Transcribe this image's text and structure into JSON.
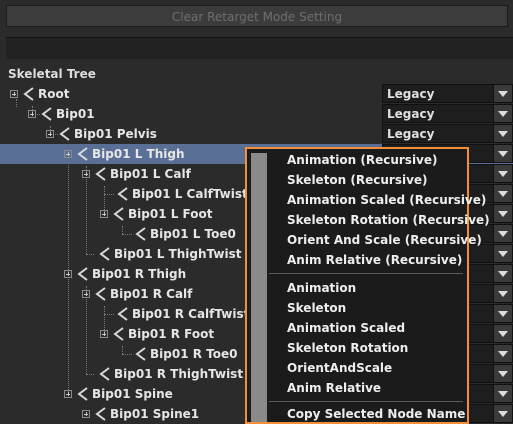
{
  "header": {
    "clear_button": "Clear Retarget Mode Setting"
  },
  "tree": {
    "title": "Skeletal Tree",
    "nodes": [
      {
        "label": "Root"
      },
      {
        "label": "Bip01"
      },
      {
        "label": "Bip01 Pelvis"
      },
      {
        "label": "Bip01 L Thigh"
      },
      {
        "label": "Bip01 L Calf"
      },
      {
        "label": "Bip01 L CalfTwist"
      },
      {
        "label": "Bip01 L Foot"
      },
      {
        "label": "Bip01 L Toe0"
      },
      {
        "label": "Bip01 L ThighTwist"
      },
      {
        "label": "Bip01 R Thigh"
      },
      {
        "label": "Bip01 R Calf"
      },
      {
        "label": "Bip01 R CalfTwist"
      },
      {
        "label": "Bip01 R Foot"
      },
      {
        "label": "Bip01 R Toe0"
      },
      {
        "label": "Bip01 R ThighTwist"
      },
      {
        "label": "Bip01 Spine"
      },
      {
        "label": "Bip01 Spine1"
      }
    ]
  },
  "modes": {
    "root": "Legacy",
    "bip01": "Legacy",
    "pelvis": "Legacy"
  },
  "context_menu": {
    "items": [
      "Animation (Recursive)",
      "Skeleton (Recursive)",
      "Animation Scaled (Recursive)",
      "Skeleton Rotation (Recursive)",
      "Orient And Scale (Recursive)",
      "Anim Relative (Recursive)",
      "Animation",
      "Skeleton",
      "Animation Scaled",
      "Skeleton Rotation",
      "OrientAndScale",
      "Anim Relative",
      "Copy Selected Node Name"
    ]
  },
  "colors": {
    "selection": "#5a6f95",
    "menu_border": "#f0903a",
    "bone_icon": "#d8d8d8"
  }
}
